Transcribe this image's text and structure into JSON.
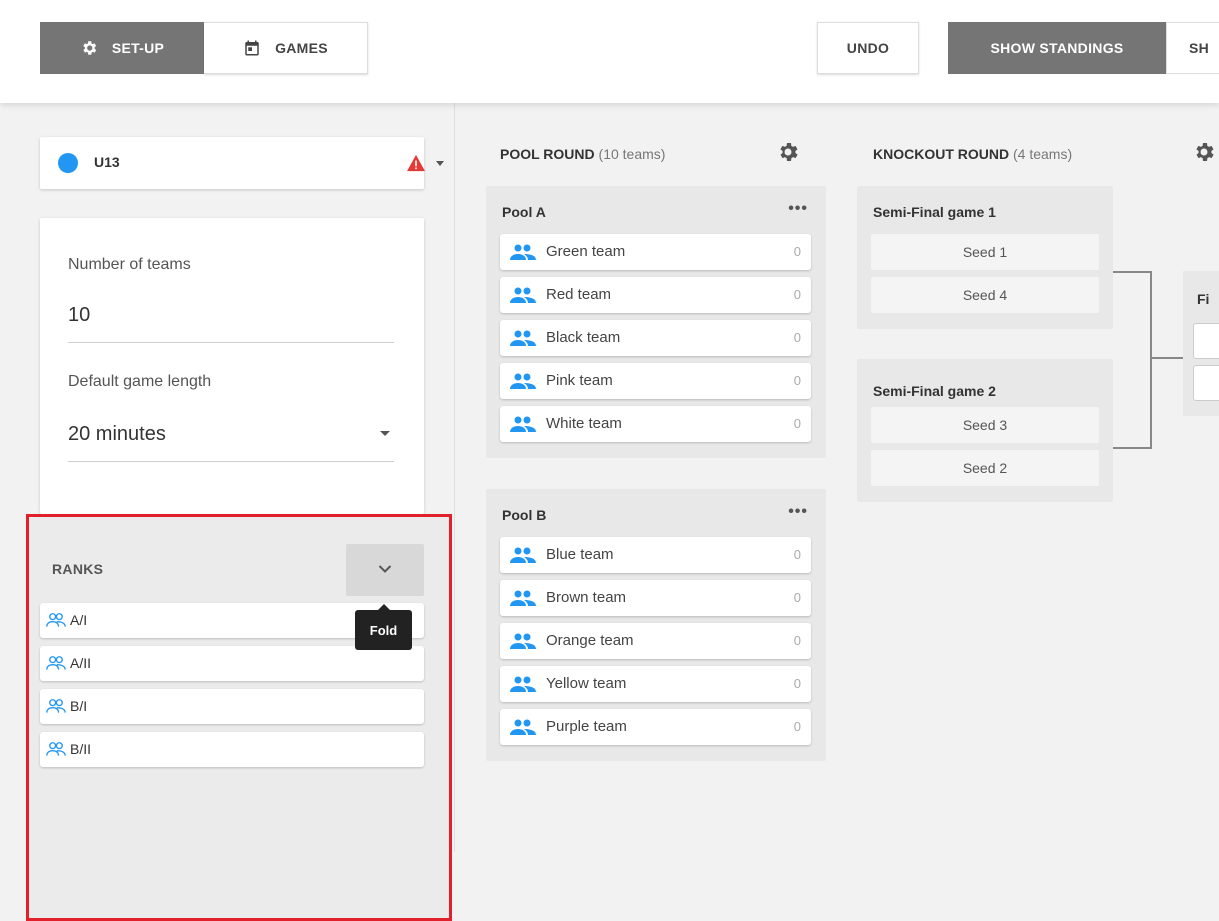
{
  "toolbar": {
    "setup_label": "SET-UP",
    "games_label": "GAMES",
    "undo_label": "UNDO",
    "show_standings_label": "SHOW STANDINGS",
    "show_cut_label": "SH"
  },
  "division": {
    "name": "U13",
    "color": "#2196f3",
    "warning_color": "#e53935"
  },
  "settings": {
    "teams_label": "Number of teams",
    "teams_value": "10",
    "length_label": "Default game length",
    "length_value": "20 minutes"
  },
  "ranks": {
    "title": "RANKS",
    "tooltip": "Fold",
    "items": [
      "A/I",
      "A/II",
      "B/I",
      "B/II"
    ]
  },
  "pool_round": {
    "title": "POOL ROUND",
    "count": "(10 teams)",
    "pools": [
      {
        "name": "Pool A",
        "more": "•••",
        "teams": [
          {
            "name": "Green team",
            "score": "0"
          },
          {
            "name": "Red team",
            "score": "0"
          },
          {
            "name": "Black team",
            "score": "0"
          },
          {
            "name": "Pink team",
            "score": "0"
          },
          {
            "name": "White team",
            "score": "0"
          }
        ]
      },
      {
        "name": "Pool B",
        "more": "•••",
        "teams": [
          {
            "name": "Blue team",
            "score": "0"
          },
          {
            "name": "Brown team",
            "score": "0"
          },
          {
            "name": "Orange team",
            "score": "0"
          },
          {
            "name": "Yellow team",
            "score": "0"
          },
          {
            "name": "Purple team",
            "score": "0"
          }
        ]
      }
    ]
  },
  "knockout_round": {
    "title": "KNOCKOUT ROUND",
    "count": "(4 teams)",
    "games": [
      {
        "name": "Semi-Final game 1",
        "seeds": [
          "Seed 1",
          "Seed 4"
        ]
      },
      {
        "name": "Semi-Final game 2",
        "seeds": [
          "Seed 3",
          "Seed 2"
        ]
      }
    ],
    "final_label": "Fi"
  },
  "colors": {
    "accent": "#2196f3",
    "highlight_border": "#e0202a",
    "toolbar_active": "#757575"
  }
}
